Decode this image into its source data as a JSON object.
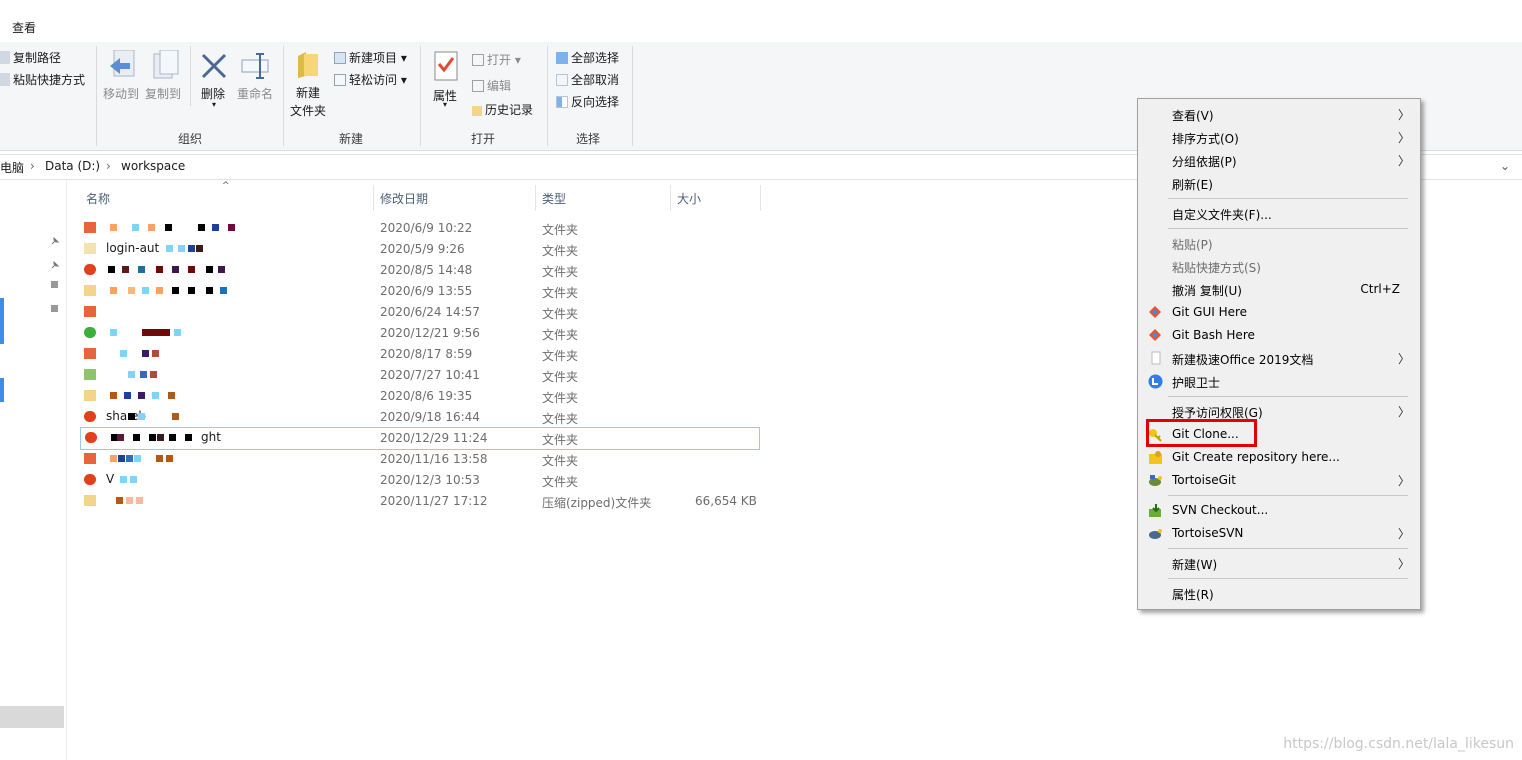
{
  "ribbon": {
    "tab_view": "查看",
    "clipboard": {
      "copy_path": "复制路径",
      "paste_shortcut": "粘贴快捷方式"
    },
    "organize": {
      "move_to": "移动到",
      "copy_to": "复制到",
      "delete": "删除",
      "rename": "重命名",
      "group_label": "组织"
    },
    "new": {
      "new_folder_line1": "新建",
      "new_folder_line2": "文件夹",
      "new_item": "新建项目",
      "easy_access": "轻松访问",
      "group_label": "新建"
    },
    "open": {
      "properties": "属性",
      "open": "打开",
      "edit": "编辑",
      "history": "历史记录",
      "group_label": "打开"
    },
    "select": {
      "select_all": "全部选择",
      "select_none": "全部取消",
      "invert": "反向选择",
      "group_label": "选择"
    }
  },
  "address": {
    "crumbs": [
      "电脑",
      "Data (D:)",
      "workspace"
    ]
  },
  "columns": {
    "name": "名称",
    "modified": "修改日期",
    "type": "类型",
    "size": "大小"
  },
  "files": [
    {
      "name": "",
      "date": "2020/6/9 10:22",
      "type": "文件夹",
      "size": ""
    },
    {
      "name": "login-aut",
      "date": "2020/5/9 9:26",
      "type": "文件夹",
      "size": ""
    },
    {
      "name": "",
      "date": "2020/8/5 14:48",
      "type": "文件夹",
      "size": ""
    },
    {
      "name": "",
      "date": "2020/6/9 13:55",
      "type": "文件夹",
      "size": ""
    },
    {
      "name": "",
      "date": "2020/6/24 14:57",
      "type": "文件夹",
      "size": ""
    },
    {
      "name": "",
      "date": "2020/12/21 9:56",
      "type": "文件夹",
      "size": ""
    },
    {
      "name": "",
      "date": "2020/8/17 8:59",
      "type": "文件夹",
      "size": ""
    },
    {
      "name": "",
      "date": "2020/7/27 10:41",
      "type": "文件夹",
      "size": ""
    },
    {
      "name": "",
      "date": "2020/8/6 19:35",
      "type": "文件夹",
      "size": ""
    },
    {
      "name": "sha     eb",
      "date": "2020/9/18 16:44",
      "type": "文件夹",
      "size": ""
    },
    {
      "name": "ght",
      "date": "2020/12/29 11:24",
      "type": "文件夹",
      "size": ""
    },
    {
      "name": "",
      "date": "2020/11/16 13:58",
      "type": "文件夹",
      "size": ""
    },
    {
      "name": "V",
      "date": "2020/12/3 10:53",
      "type": "文件夹",
      "size": ""
    },
    {
      "name": "",
      "date": "2020/11/27 17:12",
      "type": "压缩(zipped)文件夹",
      "size": "66,654 KB"
    }
  ],
  "context_menu": {
    "view": "查看(V)",
    "sort_by": "排序方式(O)",
    "group_by": "分组依据(P)",
    "refresh": "刷新(E)",
    "customize": "自定义文件夹(F)...",
    "paste": "粘贴(P)",
    "paste_shortcut": "粘贴快捷方式(S)",
    "undo_copy": "撤消 复制(U)",
    "undo_shortcut": "Ctrl+Z",
    "git_gui": "Git GUI Here",
    "git_bash": "Git Bash Here",
    "new_office": "新建极速Office 2019文档",
    "eye_guard": "护眼卫士",
    "grant_access": "授予访问权限(G)",
    "git_clone": "Git Clone...",
    "git_create": "Git Create repository here...",
    "tortoisegit": "TortoiseGit",
    "svn_checkout": "SVN Checkout...",
    "tortoisesvn": "TortoiseSVN",
    "new": "新建(W)",
    "properties": "属性(R)"
  },
  "watermark": "https://blog.csdn.net/lala_likesun",
  "colors": {
    "highlight_box": "#e20000",
    "menu_bg": "#f0f0f0",
    "accent_blue": "#3c8ee9"
  }
}
